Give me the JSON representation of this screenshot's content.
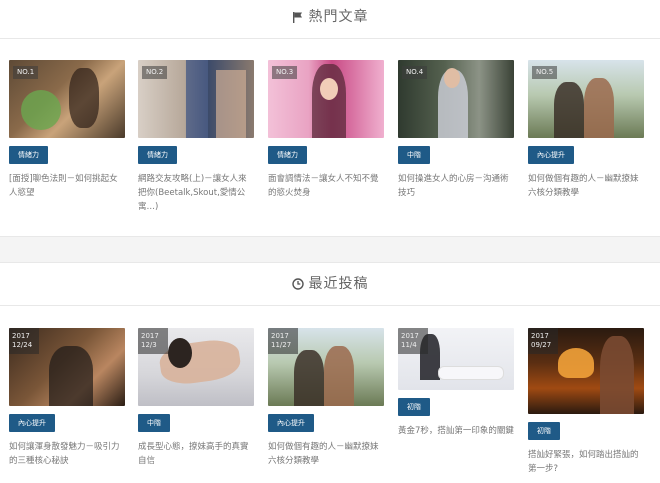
{
  "popular": {
    "heading": "熱門文章",
    "posts": [
      {
        "rank": "NO.1",
        "tag": "情緒力",
        "title": "[面授]聊色法則－如何挑起女人慾望"
      },
      {
        "rank": "NO.2",
        "tag": "情緒力",
        "title": "網路交友攻略(上)－讓女人來把你(Beetalk,Skout,愛情公寓…)"
      },
      {
        "rank": "NO.3",
        "tag": "情緒力",
        "title": "面會調情法－讓女人不知不覺的慾火焚身"
      },
      {
        "rank": "NO.4",
        "tag": "中階",
        "title": "如何操進女人的心房－沟通術技巧"
      },
      {
        "rank": "NO.5",
        "tag": "內心提升",
        "title": "如何做個有趣的人－幽默撩妹六核分類教學"
      }
    ]
  },
  "recent": {
    "heading": "最近投稿",
    "posts": [
      {
        "year": "2017",
        "day": "12/24",
        "tag": "內心提升",
        "title": "如何讓渾身散發魅力－吸引力的三種核心秘訣"
      },
      {
        "year": "2017",
        "day": "12/3",
        "tag": "中階",
        "title": "成長型心態，撩妹高手的真實自信"
      },
      {
        "year": "2017",
        "day": "11/27",
        "tag": "內心提升",
        "title": "如何做個有趣的人－幽默撩妹六核分類教學"
      },
      {
        "year": "2017",
        "day": "11/4",
        "tag": "初階",
        "title": "黃金7秒，搭訕第一印象的關鍵"
      },
      {
        "year": "2017",
        "day": "09/27",
        "tag": "初階",
        "title": "搭訕好緊張，如何踏出搭訕的第一步?"
      }
    ]
  }
}
